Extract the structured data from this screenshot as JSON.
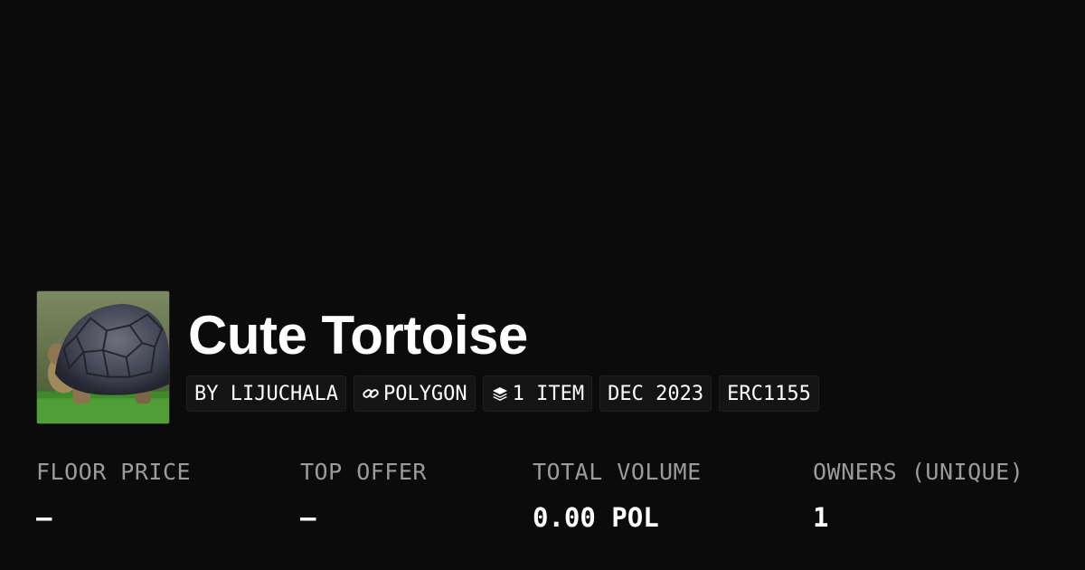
{
  "collection": {
    "title": "Cute Tortoise",
    "image_alt": "tortoise-thumbnail"
  },
  "tags": {
    "creator": "BY LIJUCHALA",
    "chain": "POLYGON",
    "chain_icon": "polygon-link-icon",
    "items": "1 ITEM",
    "items_icon": "layers-icon",
    "date": "DEC 2023",
    "standard": "ERC1155"
  },
  "stats": [
    {
      "label": "FLOOR PRICE",
      "value": "–"
    },
    {
      "label": "TOP OFFER",
      "value": "–"
    },
    {
      "label": "TOTAL VOLUME",
      "value": "0.00 POL"
    },
    {
      "label": "OWNERS (UNIQUE)",
      "value": "1"
    }
  ],
  "colors": {
    "background": "#0b0b0b",
    "tag_background": "#141414",
    "label_gray": "#9b9b9b",
    "text": "#ffffff"
  }
}
